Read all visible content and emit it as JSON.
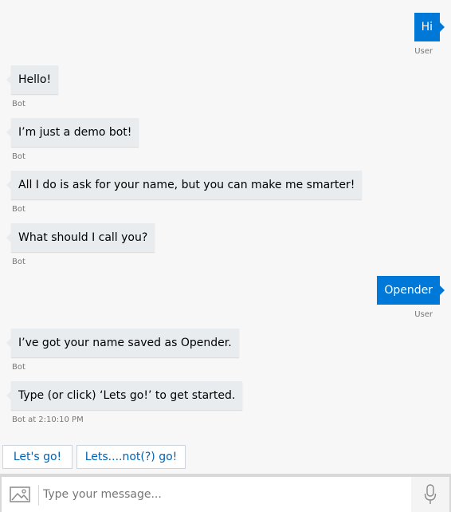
{
  "messages": [
    {
      "role": "user",
      "text": "Hi",
      "caption": "User"
    },
    {
      "role": "bot",
      "text": "Hello!",
      "caption": "Bot"
    },
    {
      "role": "bot",
      "text": "I’m just a demo bot!",
      "caption": "Bot"
    },
    {
      "role": "bot",
      "text": "All I do is ask for your name, but you can make me smarter!",
      "caption": "Bot"
    },
    {
      "role": "bot",
      "text": "What should I call you?",
      "caption": "Bot"
    },
    {
      "role": "user",
      "text": "Opender",
      "caption": "User"
    },
    {
      "role": "bot",
      "text": "I’ve got your name saved as Opender.",
      "caption": "Bot"
    },
    {
      "role": "bot",
      "text": "Type (or click) ‘Lets go!’ to get started.",
      "caption": "Bot at 2:10:10 PM"
    }
  ],
  "suggested_actions": [
    "Let's go!",
    "Lets....not(?) go!"
  ],
  "input": {
    "placeholder": "Type your message...",
    "value": ""
  },
  "icons": {
    "upload": "image-icon",
    "mic": "microphone-icon"
  },
  "colors": {
    "user_bubble": "#0078d7",
    "bot_bubble": "#e9ecef",
    "suggested_text": "#0063b1"
  }
}
